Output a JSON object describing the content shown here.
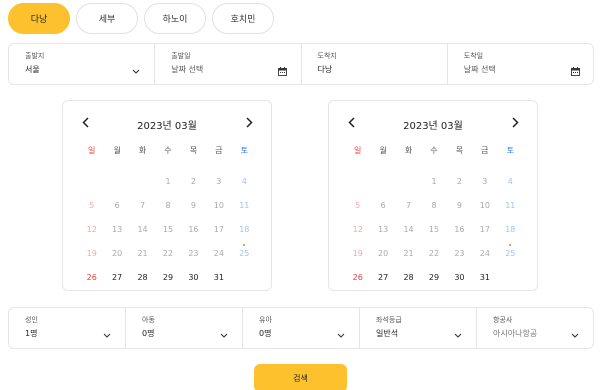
{
  "tabs": [
    {
      "label": "다낭",
      "active": true
    },
    {
      "label": "세부",
      "active": false
    },
    {
      "label": "하노이",
      "active": false
    },
    {
      "label": "호치민",
      "active": false
    }
  ],
  "route": {
    "departure": {
      "label": "출발지",
      "value": "서울"
    },
    "depart_date": {
      "label": "출발일",
      "value": "날짜 선택"
    },
    "arrival": {
      "label": "도착지",
      "value": "다낭"
    },
    "arrive_date": {
      "label": "도착일",
      "value": "날짜 선택"
    }
  },
  "calendars": [
    {
      "title": "2023년 03월"
    },
    {
      "title": "2023년 03월"
    }
  ],
  "weekdays": [
    "일",
    "월",
    "화",
    "수",
    "목",
    "금",
    "토"
  ],
  "month": {
    "first_weekday": 3,
    "days": 31,
    "past_until": 25,
    "dot_day": 25
  },
  "passengers": {
    "adult": {
      "label": "성인",
      "value": "1명"
    },
    "child": {
      "label": "아동",
      "value": "0명"
    },
    "infant": {
      "label": "유아",
      "value": "0명"
    },
    "seat_class": {
      "label": "좌석등급",
      "value": "일반석"
    },
    "airline": {
      "label": "항공사",
      "value": "아시아나항공"
    }
  },
  "search_label": "검색",
  "colors": {
    "accent": "#fdc12d",
    "sunday": "#e94040",
    "saturday": "#2f7ae5"
  },
  "icons": {
    "calendar": "calendar-icon",
    "chevron": "chevron-down-icon",
    "prev": "chevron-left-icon",
    "next": "chevron-right-icon"
  }
}
